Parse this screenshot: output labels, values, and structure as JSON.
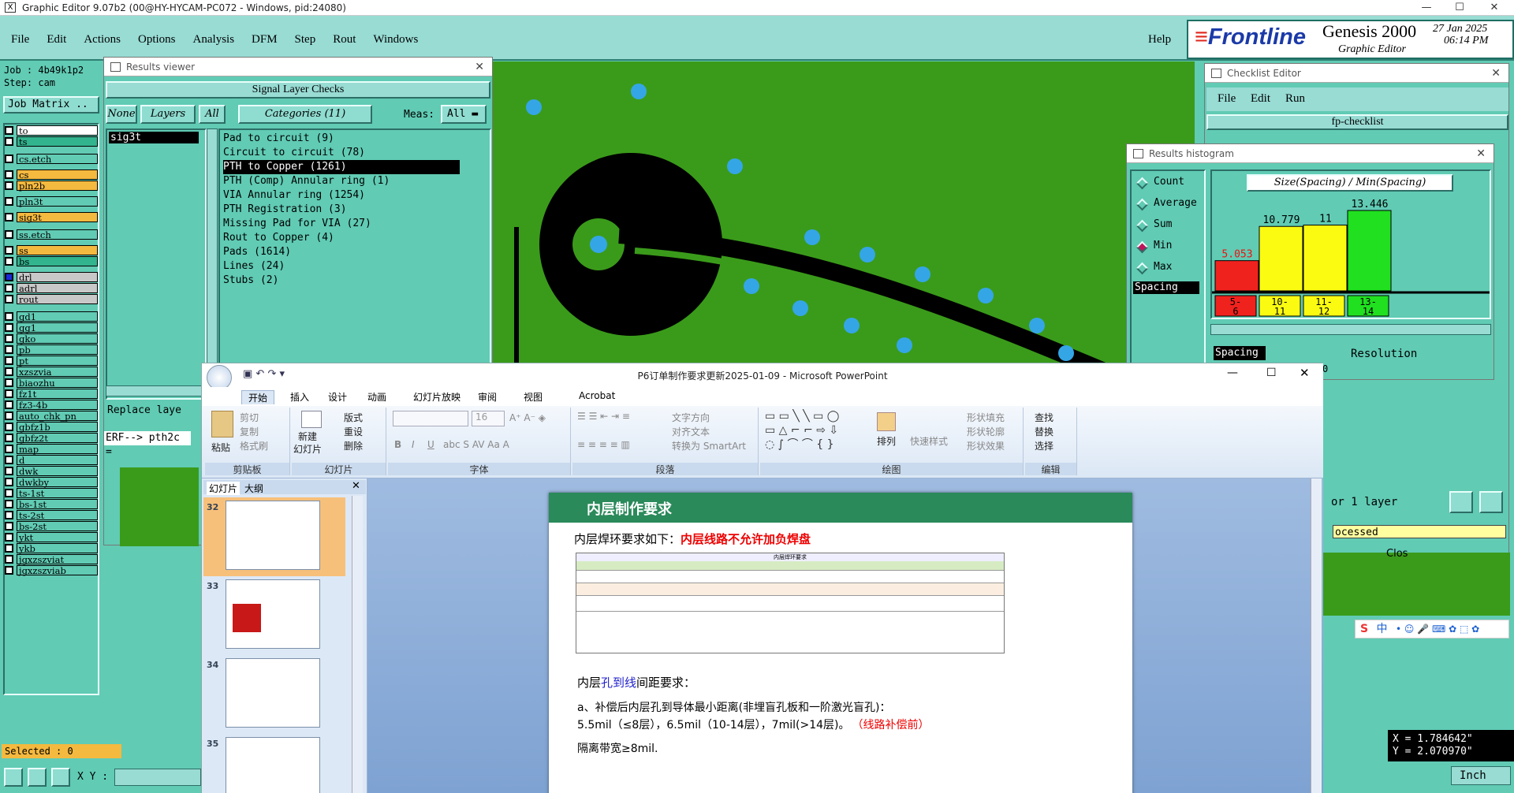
{
  "os": {
    "title": "Graphic Editor 9.07b2 (00@HY-HYCAM-PC072 - Windows, pid:24080)",
    "min": "—",
    "max": "☐",
    "close": "✕"
  },
  "genesis": {
    "menu": [
      "File",
      "Edit",
      "Actions",
      "Options",
      "Analysis",
      "DFM",
      "Step",
      "Rout",
      "Windows"
    ],
    "help": "Help",
    "brand": "Frontline",
    "product": "Genesis 2000",
    "subtitle": "Graphic Editor",
    "date": "27 Jan 2025",
    "time": "06:14 PM",
    "job": "Job : 4b49k1p2",
    "step": "Step: cam",
    "job_matrix": "Job Matrix ..",
    "selected": "Selected : 0",
    "xy_label": "X Y :",
    "coord_x": "X = 1.784642\"",
    "coord_y": "Y = 2.070970\"",
    "units": "Inch",
    "layers": [
      {
        "name": "to",
        "color": "#ffffff"
      },
      {
        "name": "ts",
        "color": "#32b48f"
      },
      {
        "name": "cs.etch",
        "color": "#61cbb4"
      },
      {
        "name": "cs",
        "color": "#f4b93f"
      },
      {
        "name": "pln2b",
        "color": "#f4b93f"
      },
      {
        "name": "pln3t",
        "color": "#61cbb4"
      },
      {
        "name": "sig3t",
        "color": "#f4b93f"
      },
      {
        "name": "ss.etch",
        "color": "#61cbb4"
      },
      {
        "name": "ss",
        "color": "#f4b93f"
      },
      {
        "name": "bs",
        "color": "#32b48f"
      },
      {
        "name": "drl",
        "color": "#c8c8c8"
      },
      {
        "name": "adrl",
        "color": "#c8c8c8"
      },
      {
        "name": "rout",
        "color": "#c8c8c8"
      },
      {
        "name": "gd1",
        "color": "#61cbb4"
      },
      {
        "name": "gg1",
        "color": "#61cbb4"
      },
      {
        "name": "gko",
        "color": "#61cbb4"
      },
      {
        "name": "pb",
        "color": "#61cbb4"
      },
      {
        "name": "pt",
        "color": "#61cbb4"
      },
      {
        "name": "xzszvia",
        "color": "#61cbb4"
      },
      {
        "name": "biaozhu",
        "color": "#61cbb4"
      },
      {
        "name": "fz1t",
        "color": "#61cbb4"
      },
      {
        "name": "fz3-4b",
        "color": "#61cbb4"
      },
      {
        "name": "auto_chk_pn",
        "color": "#61cbb4"
      },
      {
        "name": "gbfz1b",
        "color": "#61cbb4"
      },
      {
        "name": "gbfz2t",
        "color": "#61cbb4"
      },
      {
        "name": "map",
        "color": "#61cbb4"
      },
      {
        "name": "d",
        "color": "#61cbb4"
      },
      {
        "name": "dwk",
        "color": "#61cbb4"
      },
      {
        "name": "dwkby",
        "color": "#61cbb4"
      },
      {
        "name": "ts-1st",
        "color": "#61cbb4"
      },
      {
        "name": "bs-1st",
        "color": "#61cbb4"
      },
      {
        "name": "ts-2st",
        "color": "#61cbb4"
      },
      {
        "name": "bs-2st",
        "color": "#61cbb4"
      },
      {
        "name": "ykt",
        "color": "#61cbb4"
      },
      {
        "name": "ykb",
        "color": "#61cbb4"
      },
      {
        "name": "jgxzszviat",
        "color": "#61cbb4"
      },
      {
        "name": "jgxzszviab",
        "color": "#61cbb4"
      }
    ]
  },
  "results_viewer": {
    "title": "Results viewer",
    "close": "✕",
    "header": "Signal Layer Checks",
    "none": "None",
    "layers": "Layers",
    "all": "All",
    "categories": "Categories (11)",
    "meas": "Meas:",
    "meas_value": "All",
    "layer_items": [
      "sig3t"
    ],
    "category_items": [
      "Pad to circuit (9)",
      "Circuit to circuit (78)",
      "PTH to Copper (1261)",
      "PTH (Comp) Annular ring (1)",
      "VIA Annular ring (1254)",
      "PTH Registration (3)",
      "Missing Pad for VIA (27)",
      "Rout to Copper (4)",
      "Pads (1614)",
      "Lines (24)",
      "Stubs (2)"
    ],
    "selected_category": "PTH to Copper (1261)",
    "replace": "Replace laye",
    "erf": "ERF--> pth2c ="
  },
  "checklist": {
    "title": "Checklist Editor",
    "close": "✕",
    "menu": [
      "File",
      "Edit",
      "Run"
    ],
    "name": "fp-checklist",
    "for_layer": "or 1 layer",
    "processed": "ocessed",
    "close_btn": "Clos"
  },
  "histogram": {
    "title": "Results histogram",
    "close": "✕",
    "modes": [
      "Count",
      "Average",
      "Sum",
      "Min",
      "Max"
    ],
    "selected_mode": "Min",
    "list_item": "Spacing",
    "chart_title": "Size(Spacing) / Min(Spacing)",
    "spacing_label": "Spacing",
    "resolution": "Resolution",
    "resolution_value": "0",
    "colors": {
      "red": "#f0221e",
      "yellow": "#fbfb12",
      "green": "#20e020"
    }
  },
  "chart_data": {
    "type": "bar",
    "title": "Size(Spacing) / Min(Spacing)",
    "categories": [
      "5-6",
      "10-11",
      "11-12",
      "13-14"
    ],
    "values": [
      5.053,
      10.779,
      11,
      13.446
    ],
    "value_labels": [
      "5.053",
      "10.779",
      "11",
      "13.446"
    ],
    "category_labels": [
      [
        "5-",
        "6"
      ],
      [
        "10-",
        "11"
      ],
      [
        "11-",
        "12"
      ],
      [
        "13-",
        "14"
      ]
    ],
    "bar_colors": [
      "#f0221e",
      "#fbfb12",
      "#fbfb12",
      "#20e020"
    ],
    "ylim": [
      0,
      13.446
    ]
  },
  "powerpoint": {
    "title": "P6订单制作要求更新2025-01-09 - Microsoft PowerPoint",
    "tabs": [
      "开始",
      "插入",
      "设计",
      "动画",
      "幻灯片放映",
      "审阅",
      "视图",
      "Acrobat"
    ],
    "groups": [
      "剪贴板",
      "幻灯片",
      "字体",
      "段落",
      "绘图",
      "编辑"
    ],
    "clipboard": {
      "paste": "粘贴",
      "cut": "剪切",
      "copy": "复制",
      "format": "格式刷"
    },
    "slides_grp": {
      "new": "新建",
      "new2": "幻灯片",
      "layout": "版式",
      "reset": "重设",
      "delete": "删除"
    },
    "font": {
      "size": "16"
    },
    "para": {
      "dir": "文字方向",
      "align": "对齐文本",
      "smartart": "转换为 SmartArt"
    },
    "draw": {
      "arrange": "排列",
      "quick": "快速样式",
      "fill": "形状填充",
      "outline": "形状轮廓",
      "effect": "形状效果"
    },
    "edit": {
      "find": "查找",
      "replace": "替换",
      "select": "选择"
    },
    "panel_tabs": [
      "幻灯片",
      "大纲"
    ],
    "thumb_numbers": [
      "32",
      "33",
      "34",
      "35"
    ],
    "slide": {
      "header": "内层制作要求",
      "line1a": "内层焊环要求如下：",
      "line1b": "内层线路不允许加负焊盘",
      "table_title": "内层焊环要求",
      "line2a": "内层",
      "line2b": "孔到线",
      "line2c": "间距要求：",
      "line3": "a、补偿后内层孔到导体最小距离(非埋盲孔板和一阶激光盲孔)：",
      "line4a": "5.5mil（≤8层），6.5mil（10-14层），7mil(>14层)。",
      "line4b": "（线路补偿前）",
      "line5": "隔离带宽≥8mil."
    }
  },
  "ime": {
    "label": "中"
  }
}
